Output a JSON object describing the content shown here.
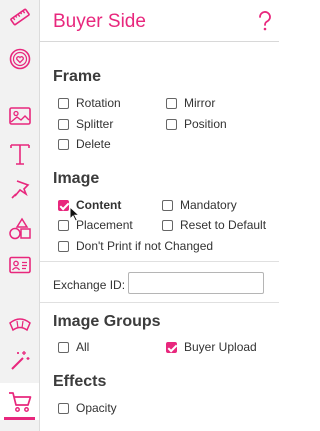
{
  "accent_color": "#e8277d",
  "toolbar": {
    "tools": [
      {
        "icon": "ruler-icon"
      },
      {
        "icon": "badge-heart-icon"
      },
      {
        "icon": "image-icon"
      },
      {
        "icon": "text-icon"
      },
      {
        "icon": "pin-icon"
      },
      {
        "icon": "shapes-icon"
      },
      {
        "icon": "id-card-icon"
      },
      {
        "icon": "curve-icon"
      },
      {
        "icon": "magic-wand-icon"
      },
      {
        "icon": "cart-icon",
        "active": true
      }
    ]
  },
  "header": {
    "title": "Buyer Side",
    "help_icon": "help-icon"
  },
  "frame": {
    "title": "Frame",
    "rotation": {
      "label": "Rotation",
      "checked": false
    },
    "mirror": {
      "label": "Mirror",
      "checked": false
    },
    "splitter": {
      "label": "Splitter",
      "checked": false
    },
    "position": {
      "label": "Position",
      "checked": false
    },
    "delete": {
      "label": "Delete",
      "checked": false
    }
  },
  "image": {
    "title": "Image",
    "content": {
      "label": "Content",
      "checked": true
    },
    "mandatory": {
      "label": "Mandatory",
      "checked": false
    },
    "placement": {
      "label": "Placement",
      "checked": false
    },
    "reset_to_default": {
      "label": "Reset to Default",
      "checked": false
    },
    "dont_print": {
      "label": "Don't Print if not Changed",
      "checked": false
    }
  },
  "exchange": {
    "label": "Exchange ID:",
    "value": "",
    "placeholder": ""
  },
  "image_groups": {
    "title": "Image Groups",
    "all": {
      "label": "All",
      "checked": false
    },
    "buyer_upload": {
      "label": "Buyer Upload",
      "checked": true
    }
  },
  "effects": {
    "title": "Effects",
    "opacity": {
      "label": "Opacity",
      "checked": false
    }
  }
}
